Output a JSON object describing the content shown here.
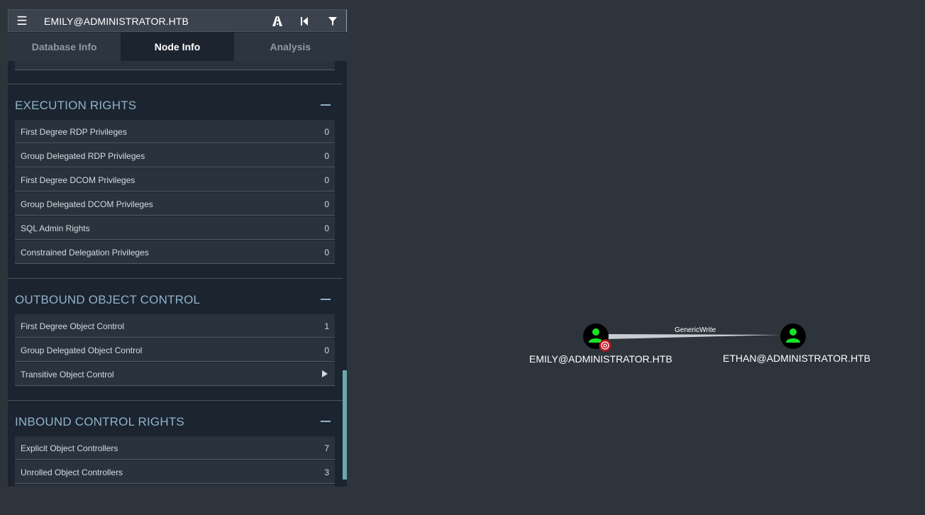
{
  "header": {
    "search_value": "EMILY@ADMINISTRATOR.HTB",
    "menu_icon": "hamburger-icon",
    "icons": [
      "pathfinding-icon",
      "back-icon",
      "filter-icon"
    ]
  },
  "tabs": [
    {
      "label": "Database Info"
    },
    {
      "label": "Node Info"
    },
    {
      "label": "Analysis"
    }
  ],
  "sections": {
    "execution_rights": {
      "title": "EXECUTION RIGHTS",
      "rows": [
        {
          "label": "First Degree RDP Privileges",
          "count": "0"
        },
        {
          "label": "Group Delegated RDP Privileges",
          "count": "0"
        },
        {
          "label": "First Degree DCOM Privileges",
          "count": "0"
        },
        {
          "label": "Group Delegated DCOM Privileges",
          "count": "0"
        },
        {
          "label": "SQL Admin Rights",
          "count": "0"
        },
        {
          "label": "Constrained Delegation Privileges",
          "count": "0"
        }
      ]
    },
    "outbound_object_control": {
      "title": "OUTBOUND OBJECT CONTROL",
      "rows": [
        {
          "label": "First Degree Object Control",
          "count": "1"
        },
        {
          "label": "Group Delegated Object Control",
          "count": "0"
        },
        {
          "label": "Transitive Object Control",
          "count": ""
        }
      ]
    },
    "inbound_control_rights": {
      "title": "INBOUND CONTROL RIGHTS",
      "rows": [
        {
          "label": "Explicit Object Controllers",
          "count": "7"
        },
        {
          "label": "Unrolled Object Controllers",
          "count": "3"
        }
      ]
    }
  },
  "graph": {
    "nodes": [
      {
        "label": "EMILY@ADMINISTRATOR.HTB",
        "icon": "user-icon",
        "badge": "target-icon"
      },
      {
        "label": "ETHAN@ADMINISTRATOR.HTB",
        "icon": "user-icon"
      }
    ],
    "edge": {
      "label": "GenericWrite"
    }
  },
  "colors": {
    "background": "#2e343c",
    "panel": "#1c2430",
    "section_title": "#8fb3c9",
    "user_node": "#17e625",
    "owned_badge": "#c0141e"
  }
}
